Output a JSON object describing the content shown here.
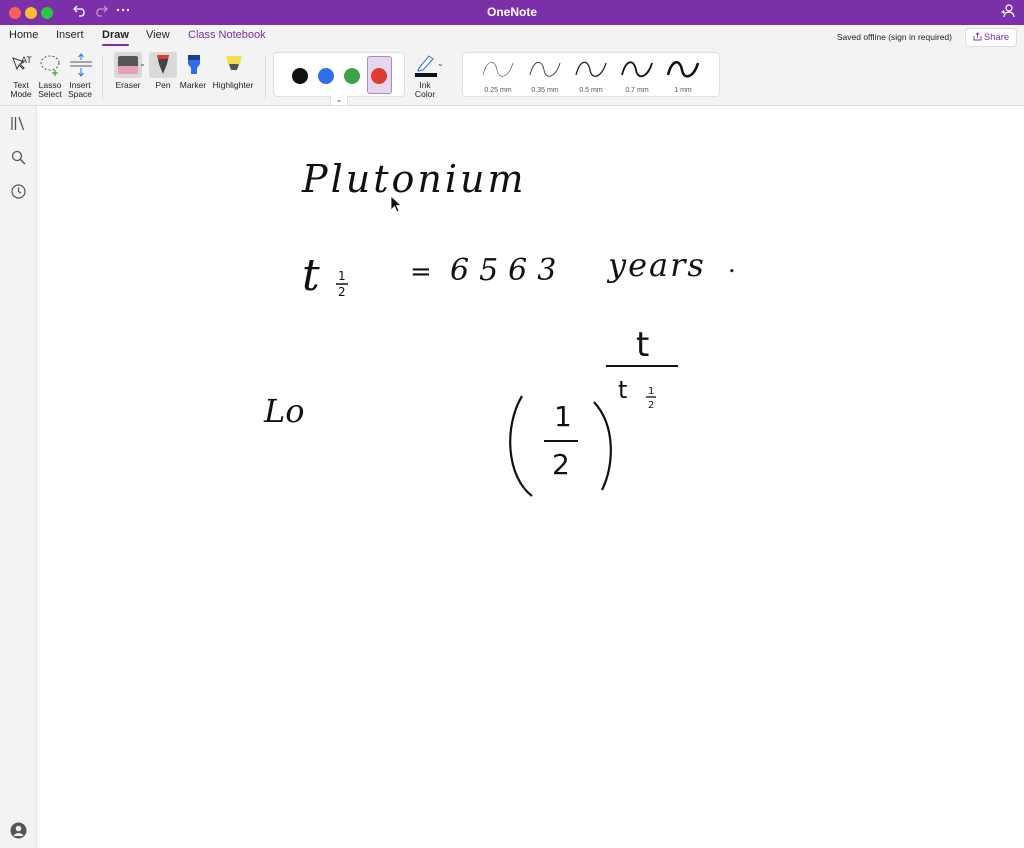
{
  "window": {
    "title": "OneNote",
    "title_bar_color": "#7b2fa8"
  },
  "titlebar_icons": {
    "undo": "undo-icon",
    "redo": "redo-icon",
    "more": "more-icon",
    "account": "account-switch-icon"
  },
  "tabs": [
    {
      "label": "Home",
      "active": false
    },
    {
      "label": "Insert",
      "active": false
    },
    {
      "label": "Draw",
      "active": true
    },
    {
      "label": "View",
      "active": false
    },
    {
      "label": "Class Notebook",
      "active": false,
      "accent": true
    }
  ],
  "status": {
    "saved": "Saved offline (sign in required)",
    "share_label": "Share"
  },
  "ribbon": {
    "text_mode": {
      "line1": "Text",
      "line2": "Mode"
    },
    "lasso_select": {
      "line1": "Lasso",
      "line2": "Select"
    },
    "insert_space": {
      "line1": "Insert",
      "line2": "Space"
    },
    "eraser": "Eraser",
    "pen": "Pen",
    "marker": "Marker",
    "highlighter": "Highlighter",
    "ink_color": {
      "line1": "Ink",
      "line2": "Color"
    },
    "colors": [
      {
        "name": "black",
        "hex": "#111111"
      },
      {
        "name": "blue",
        "hex": "#2f6ee8"
      },
      {
        "name": "green",
        "hex": "#3aa34a"
      },
      {
        "name": "red",
        "hex": "#e03b2e",
        "selected": true
      }
    ],
    "thicknesses": [
      "0.25 mm",
      "0.35 mm",
      "0.5 mm",
      "0.7 mm",
      "1 mm"
    ]
  },
  "left_rail": {
    "icons": [
      "notebooks-icon",
      "search-icon",
      "recent-icon",
      "account-icon"
    ]
  },
  "page": {
    "handwriting": {
      "word": "Plutonium",
      "half_life_symbol": "t",
      "half_life_subscript_num": "1",
      "half_life_subscript_den": "2",
      "equals": "=",
      "value": "6563",
      "unit": "years",
      "period": ".",
      "prefix": "Lo",
      "fraction_num": "1",
      "fraction_den": "2",
      "exp_num": "t",
      "exp_den": "t",
      "exp_den_sub_num": "1",
      "exp_den_sub_den": "2"
    }
  }
}
